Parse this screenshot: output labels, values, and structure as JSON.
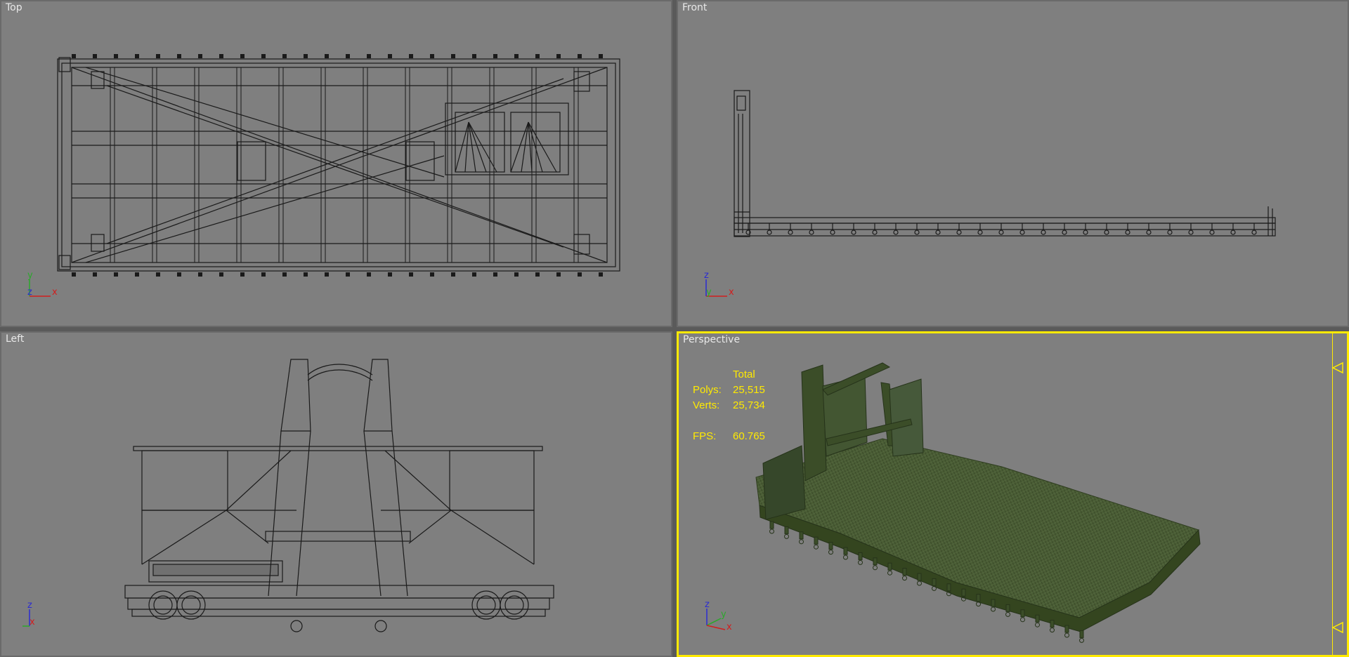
{
  "viewports": {
    "top": {
      "label": "Top",
      "axis": {
        "vertical": "y",
        "depth": "z",
        "horizontal": "x"
      }
    },
    "front": {
      "label": "Front",
      "axis": {
        "vertical": "z",
        "depth": "y",
        "horizontal": "x"
      }
    },
    "left": {
      "label": "Left",
      "axis": {
        "vertical": "z",
        "depth": "y",
        "horizontal": "x"
      }
    },
    "perspective": {
      "label": "Perspective",
      "axis": {
        "vertical": "z",
        "depth": "y",
        "horizontal": "x"
      },
      "stats": {
        "header": "Total",
        "polys_label": "Polys:",
        "polys_value": "25,515",
        "verts_label": "Verts:",
        "verts_value": "25,734",
        "fps_label": "FPS:",
        "fps_value": "60.765"
      }
    }
  },
  "colors": {
    "viewport_bg": "#7f7f7f",
    "active_border": "#ffea00",
    "wire": "#1a1a1a",
    "model_green": "#3b4d28",
    "axis_x": "#d21e1e",
    "axis_y": "#2ba82b",
    "axis_z": "#2b2bd2"
  }
}
